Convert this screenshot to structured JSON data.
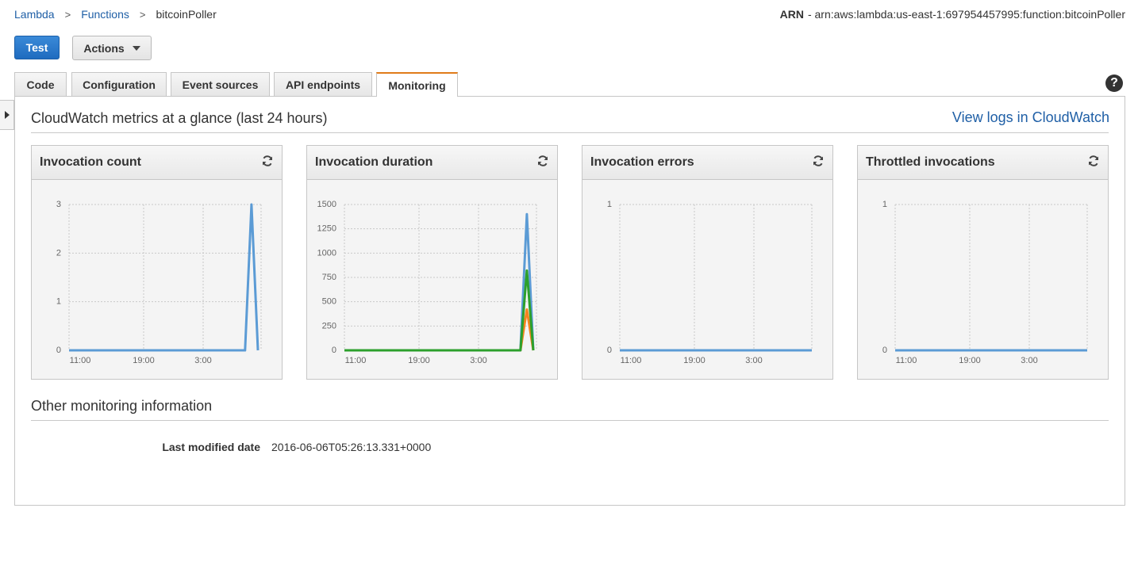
{
  "breadcrumb": {
    "lambda": "Lambda",
    "functions": "Functions",
    "current": "bitcoinPoller",
    "separator": ">"
  },
  "arn": {
    "label": "ARN",
    "value": "- arn:aws:lambda:us-east-1:697954457995:function:bitcoinPoller"
  },
  "toolbar": {
    "test_label": "Test",
    "actions_label": "Actions"
  },
  "tabs": [
    {
      "label": "Code",
      "active": false
    },
    {
      "label": "Configuration",
      "active": false
    },
    {
      "label": "Event sources",
      "active": false
    },
    {
      "label": "API endpoints",
      "active": false
    },
    {
      "label": "Monitoring",
      "active": true
    }
  ],
  "help": {
    "icon": "help-icon",
    "glyph": "?"
  },
  "monitoring": {
    "title": "CloudWatch metrics at a glance (last 24 hours)",
    "logs_link": "View logs in CloudWatch",
    "other_title": "Other monitoring information",
    "last_modified_label": "Last modified date",
    "last_modified_value": "2016-06-06T05:26:13.331+0000"
  },
  "colors": {
    "accent_tab": "#e07b1a",
    "link": "#1f5fa6",
    "series_blue": "#5b9bd5",
    "series_orange": "#f5841f",
    "series_green": "#2ca02c"
  },
  "chart_data": [
    {
      "type": "line",
      "title": "Invocation count",
      "x_ticks": [
        "11:00",
        "19:00",
        "3:00"
      ],
      "y_ticks": [
        "0",
        "1",
        "2",
        "3"
      ],
      "ylim": [
        0,
        3
      ],
      "x_hours": [
        0,
        27.5,
        28.5,
        29.5
      ],
      "series": [
        {
          "color": "#5b9bd5",
          "values": [
            0,
            0,
            3,
            0
          ]
        }
      ]
    },
    {
      "type": "line",
      "title": "Invocation duration",
      "x_ticks": [
        "11:00",
        "19:00",
        "3:00"
      ],
      "y_ticks": [
        "0",
        "250",
        "500",
        "750",
        "1000",
        "1250",
        "1500"
      ],
      "ylim": [
        0,
        1500
      ],
      "x_hours": [
        0,
        27.5,
        28.5,
        29.5
      ],
      "series": [
        {
          "color": "#5b9bd5",
          "values": [
            0,
            0,
            1400,
            0
          ]
        },
        {
          "color": "#f5841f",
          "values": [
            0,
            0,
            420,
            0
          ]
        },
        {
          "color": "#2ca02c",
          "values": [
            0,
            0,
            820,
            0
          ]
        }
      ]
    },
    {
      "type": "line",
      "title": "Invocation errors",
      "x_ticks": [
        "11:00",
        "19:00",
        "3:00"
      ],
      "y_ticks": [
        "0",
        "1"
      ],
      "ylim": [
        0,
        1
      ],
      "x_hours": [
        0,
        30
      ],
      "series": [
        {
          "color": "#5b9bd5",
          "values": [
            0,
            0
          ]
        }
      ]
    },
    {
      "type": "line",
      "title": "Throttled invocations",
      "x_ticks": [
        "11:00",
        "19:00",
        "3:00"
      ],
      "y_ticks": [
        "0",
        "1"
      ],
      "ylim": [
        0,
        1
      ],
      "x_hours": [
        0,
        30
      ],
      "series": [
        {
          "color": "#5b9bd5",
          "values": [
            0,
            0
          ]
        }
      ]
    }
  ]
}
